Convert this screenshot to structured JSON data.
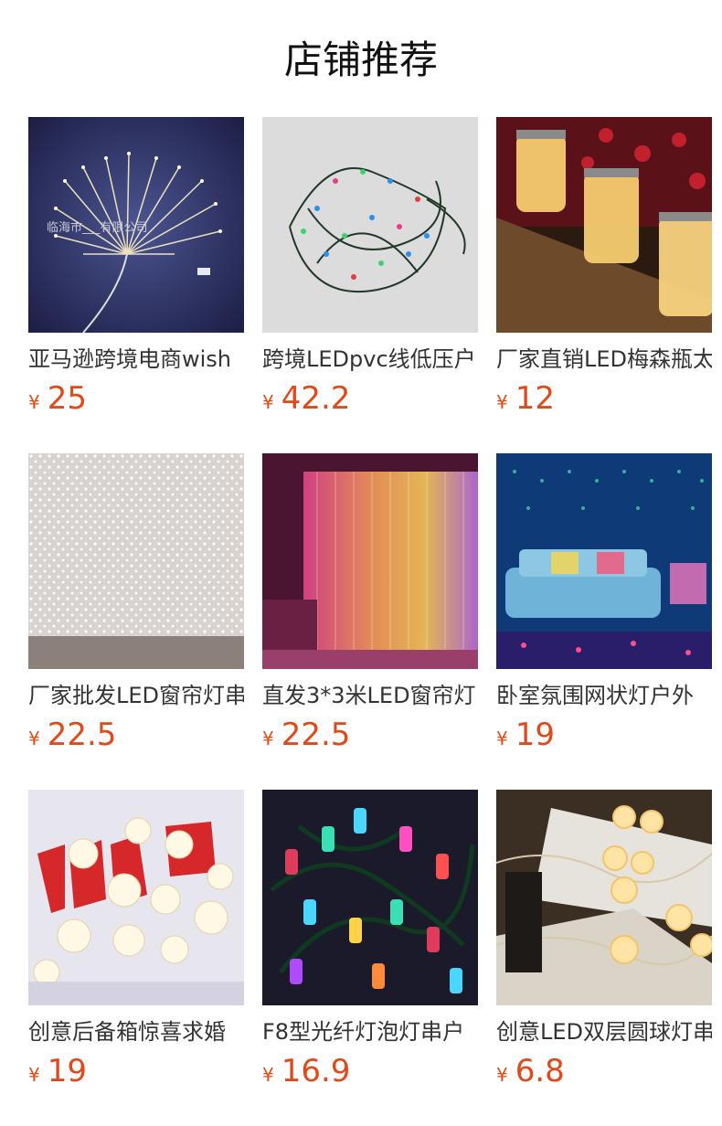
{
  "header": {
    "title": "店铺推荐"
  },
  "colors": {
    "price": "#e2491a",
    "title": "#111111",
    "name": "#333333"
  },
  "products": [
    {
      "name": "亚马逊跨境电商wish",
      "currency": "¥",
      "price": "25",
      "image_overlay": "临海市___有限公司"
    },
    {
      "name": "跨境LEDpvc线低压户",
      "currency": "¥",
      "price": "42.2"
    },
    {
      "name": "厂家直销LED梅森瓶太",
      "currency": "¥",
      "price": "12"
    },
    {
      "name": "厂家批发LED窗帘灯串",
      "currency": "¥",
      "price": "22.5"
    },
    {
      "name": "直发3*3米LED窗帘灯",
      "currency": "¥",
      "price": "22.5"
    },
    {
      "name": "卧室氛围网状灯户外",
      "currency": "¥",
      "price": "19"
    },
    {
      "name": "创意后备箱惊喜求婚",
      "currency": "¥",
      "price": "19"
    },
    {
      "name": "F8型光纤灯泡灯串户",
      "currency": "¥",
      "price": "16.9"
    },
    {
      "name": "创意LED双层圆球灯串",
      "currency": "¥",
      "price": "6.8"
    }
  ]
}
